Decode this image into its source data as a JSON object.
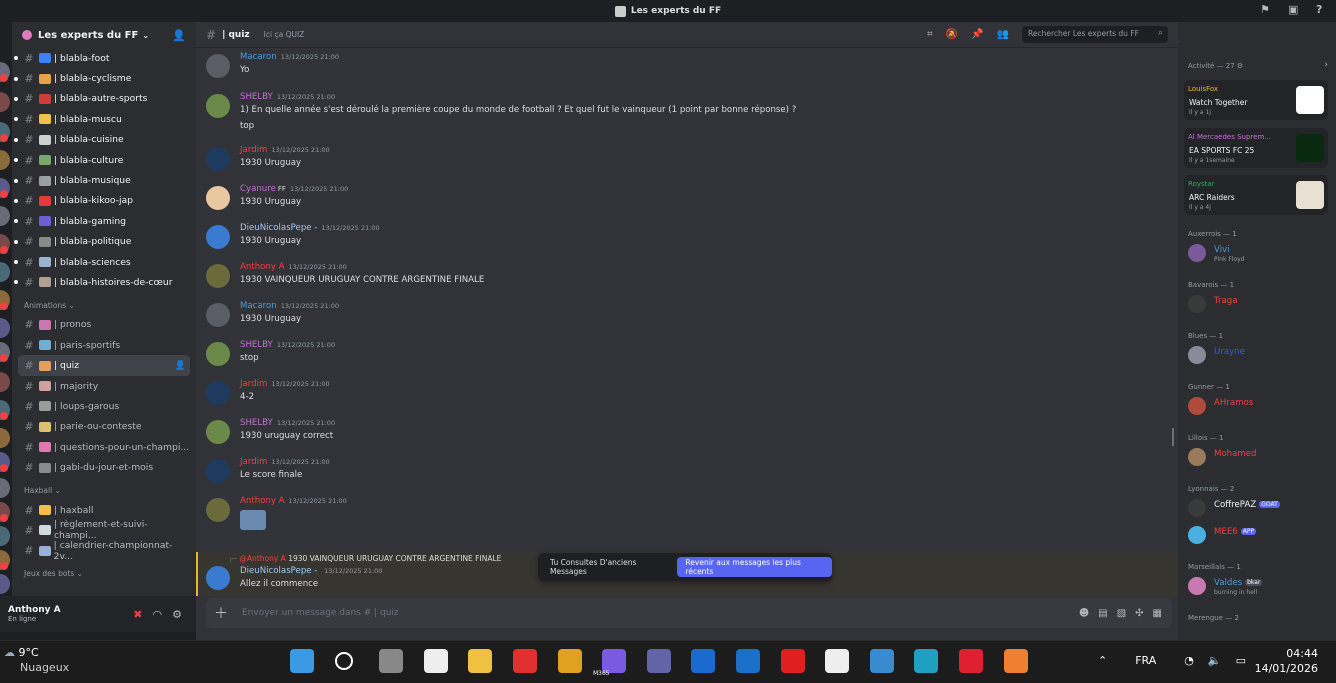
{
  "window": {
    "title": "Les experts du FF"
  },
  "guild": {
    "name": "Les experts du FF"
  },
  "channels_top": [
    {
      "label": "| blabla-foot",
      "color": "#3b82f6"
    },
    {
      "label": "| blabla-cyclisme",
      "color": "#e5a24a"
    },
    {
      "label": "| blabla-autre-sports",
      "color": "#d23b3b"
    },
    {
      "label": "| blabla-muscu",
      "color": "#f0c24a"
    },
    {
      "label": "| blabla-cuisine",
      "color": "#cfcfcf"
    },
    {
      "label": "| blabla-culture",
      "color": "#7aa86a"
    },
    {
      "label": "| blabla-musique",
      "color": "#9aa0a6"
    },
    {
      "label": "| blabla-kikoo-jap",
      "color": "#e23b3b"
    },
    {
      "label": "| blabla-gaming",
      "color": "#6b5fd3"
    },
    {
      "label": "| blabla-politique",
      "color": "#8a8a8a"
    },
    {
      "label": "| blabla-sciences",
      "color": "#9ab4d0"
    },
    {
      "label": "| blabla-histoires-de-cœur",
      "color": "#b0a090"
    }
  ],
  "categories": {
    "animations": "Animations",
    "haxball": "Haxball",
    "jeux": "Jeux des bots"
  },
  "channels_anim": [
    {
      "label": "| pronos",
      "color": "#c87ab0"
    },
    {
      "label": "| paris-sportifs",
      "color": "#6fb0d0"
    },
    {
      "label": "| quiz",
      "color": "#e0a060"
    },
    {
      "label": "| majority",
      "color": "#d0a0a0"
    },
    {
      "label": "| loups-garous",
      "color": "#9a9a9a"
    },
    {
      "label": "| parie-ou-conteste",
      "color": "#e0c070"
    },
    {
      "label": "| questions-pour-un-champi...",
      "color": "#e07ab0"
    },
    {
      "label": "| gabi-du-jour-et-mois",
      "color": "#8a8a8a"
    }
  ],
  "channels_hax": [
    {
      "label": "| haxball",
      "color": "#f0c24a"
    },
    {
      "label": "| règlement-et-suivi-champi...",
      "color": "#d0d8e0"
    },
    {
      "label": "| calendrier-championnat-2v...",
      "color": "#9ab0d8"
    }
  ],
  "user": {
    "name": "Anthony A",
    "status": "En ligne"
  },
  "header": {
    "channel": "| quiz",
    "topic": "Ici ça QUIZ",
    "search_placeholder": "Rechercher Les experts du FF"
  },
  "messages": [
    {
      "author": "Macaron",
      "color": "#4a9bd9",
      "ts": "13/12/2025 21:00",
      "lines": [
        "Yo"
      ],
      "av": "#5a5d66"
    },
    {
      "author": "SHELBY",
      "color": "#c56fd6",
      "ts": "13/12/2025 21:00",
      "lines": [
        "1) En quelle année s'est déroulé la première coupe du monde de football ? Et quel fut le vainqueur (1 point par bonne réponse) ?",
        "top"
      ],
      "av": "#6b8a4a"
    },
    {
      "author": "Jardim",
      "color": "#f23f42",
      "ts": "13/12/2025 21:00",
      "lines": [
        "1930 Uruguay"
      ],
      "av": "#1f3a5f"
    },
    {
      "author": "Cyanure",
      "color": "#c56fd6",
      "tag": "FF",
      "ts": "13/12/2025 21:00",
      "lines": [
        "1930 Uruguay"
      ],
      "av": "#e8c8a0"
    },
    {
      "author": "DieuNicolasPepe -",
      "color": "#a0c8f0",
      "ts": "13/12/2025 21:00",
      "lines": [
        "1930 Uruguay"
      ],
      "av": "#3a7ad0"
    },
    {
      "author": "Anthony A",
      "color": "#f23f42",
      "ts": "13/12/2025 21:00",
      "lines": [
        "1930 VAINQUEUR URUGUAY CONTRE ARGENTINE FINALE"
      ],
      "av": "#6a6a3a"
    },
    {
      "author": "Macaron",
      "color": "#4a9bd9",
      "ts": "13/12/2025 21:00",
      "lines": [
        "1930 Uruguay"
      ],
      "av": "#5a5d66"
    },
    {
      "author": "SHELBY",
      "color": "#c56fd6",
      "ts": "13/12/2025 21:00",
      "lines": [
        "stop"
      ],
      "av": "#6b8a4a"
    },
    {
      "author": "Jardim",
      "color": "#f23f42",
      "ts": "13/12/2025 21:00",
      "lines": [
        "4-2"
      ],
      "av": "#1f3a5f"
    },
    {
      "author": "SHELBY",
      "color": "#c56fd6",
      "ts": "13/12/2025 21:00",
      "lines": [
        "1930 uruguay correct"
      ],
      "av": "#6b8a4a"
    },
    {
      "author": "Jardim",
      "color": "#f23f42",
      "ts": "13/12/2025 21:00",
      "lines": [
        "Le score finale"
      ],
      "av": "#1f3a5f"
    },
    {
      "author": "Anthony A",
      "color": "#f23f42",
      "ts": "13/12/2025 21:00",
      "lines": [],
      "av": "#6a6a3a"
    }
  ],
  "reply": {
    "ref_author": "@Anthony A",
    "ref_text": "1930 VAINQUEUR URUGUAY CONTRE ARGENTINE FINALE",
    "author": "DieuNicolasPepe -",
    "ts": "13/12/2025 21:00",
    "text": "Allez il commence"
  },
  "jump": {
    "text": "Tu Consultes D'anciens Messages",
    "button": "Revenir aux messages les plus récents"
  },
  "composer": {
    "placeholder": "Envoyer un message dans # | quiz"
  },
  "activity": {
    "heading": "Activité — 27",
    "cards": [
      {
        "name": "LouisFox",
        "name_color": "#f0b232",
        "game": "Watch Together",
        "time": "Il y a 1j",
        "thumb": "#ffffff"
      },
      {
        "name": "Al Mercaedes Suprem...",
        "name_color": "#c56fd6",
        "game": "EA SPORTS FC 25",
        "time": "Il y a 1semaine",
        "thumb": "#0a2a10"
      },
      {
        "name": "Roystar",
        "name_color": "#3ba55d",
        "game": "ARC Raiders",
        "time": "Il y a 4j",
        "thumb": "#e8e0d0"
      }
    ]
  },
  "roles": [
    {
      "title": "Auxerrois — 1",
      "members": [
        {
          "name": "Vivi",
          "color": "#4a9bd9",
          "sub": "Pink Floyd",
          "av": "#7a5a9a"
        }
      ]
    },
    {
      "title": "Bavarois — 1",
      "members": [
        {
          "name": "Traga",
          "color": "#f23f42",
          "sub": "",
          "av": "#3a3a3a"
        }
      ]
    },
    {
      "title": "Blues — 1",
      "members": [
        {
          "name": "Urayne",
          "color": "#3b5bd9",
          "sub": "",
          "av": "#8a8a9a"
        }
      ]
    },
    {
      "title": "Gunner — 1",
      "members": [
        {
          "name": "AHramos",
          "color": "#f23f42",
          "sub": "",
          "av": "#b04a3a"
        }
      ]
    },
    {
      "title": "Lillois — 1",
      "members": [
        {
          "name": "Mohamed",
          "color": "#f23f42",
          "sub": "",
          "av": "#9a7a5a"
        }
      ]
    },
    {
      "title": "Lyonnais — 2",
      "members": [
        {
          "name": "CoffrePAZ",
          "color": "#f2f3f5",
          "badge": "GOAT",
          "badge_color": "#5865f2",
          "sub": "",
          "av": "#3a3a3a"
        },
        {
          "name": "MEE6",
          "color": "#f23f42",
          "badge": "APP",
          "badge_color": "#5865f2",
          "sub": "",
          "av": "#4ab0e0"
        }
      ]
    },
    {
      "title": "Marseillais — 1",
      "members": [
        {
          "name": "Valdes",
          "color": "#4a9bd9",
          "badge": "bkar",
          "badge_color": "#4a4a5a",
          "sub": "burning in hell",
          "av": "#c87ab0"
        }
      ]
    },
    {
      "title": "Merengue — 2",
      "members": []
    }
  ],
  "taskbar": {
    "temp": "9°C",
    "weather": "Nuageux",
    "lang": "FRA",
    "time": "04:44",
    "date": "14/01/2026",
    "m365": "M365"
  }
}
